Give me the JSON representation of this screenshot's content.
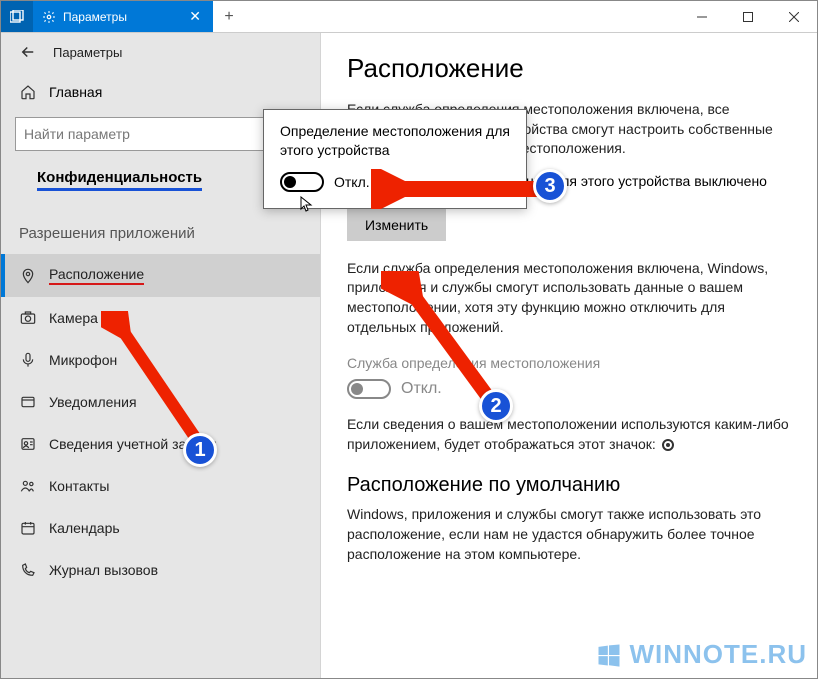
{
  "titlebar": {
    "tab_label": "Параметры",
    "new_tab": "+"
  },
  "breadcrumb": {
    "label": "Параметры"
  },
  "search": {
    "placeholder": "Найти параметр"
  },
  "sidebar": {
    "home": "Главная",
    "privacy": "Конфиденциальность",
    "section_title": "Разрешения приложений",
    "items": [
      {
        "label": "Расположение"
      },
      {
        "label": "Камера"
      },
      {
        "label": "Микрофон"
      },
      {
        "label": "Уведомления"
      },
      {
        "label": "Сведения учетной записи"
      },
      {
        "label": "Контакты"
      },
      {
        "label": "Календарь"
      },
      {
        "label": "Журнал вызовов"
      }
    ]
  },
  "content": {
    "title": "Расположение",
    "para1": "Если служба определения местоположения включена, все пользователи данного устройства смогут настроить собственные параметры определения местоположения.",
    "status": "Определение местоположения для этого устройства выключено",
    "change_btn": "Изменить",
    "para2": "Если служба определения местоположения включена, Windows, приложения и службы смогут использовать данные о вашем местоположении, хотя эту функцию можно отключить для отдельных приложений.",
    "svc_label": "Служба определения местоположения",
    "svc_state": "Откл.",
    "para3_prefix": "Если сведения о вашем местоположении используются каким-либо приложением, будет отображаться этот значок: ",
    "subtitle2": "Расположение по умолчанию",
    "para4": "Windows, приложения и службы смогут также использовать это расположение, если нам не удастся обнаружить более точное расположение на этом компьютере."
  },
  "dialog": {
    "text": "Определение местоположения для этого устройства",
    "state": "Откл."
  },
  "annotations": {
    "b1": "1",
    "b2": "2",
    "b3": "3"
  },
  "watermark": {
    "text": "WINNOTE.RU"
  }
}
